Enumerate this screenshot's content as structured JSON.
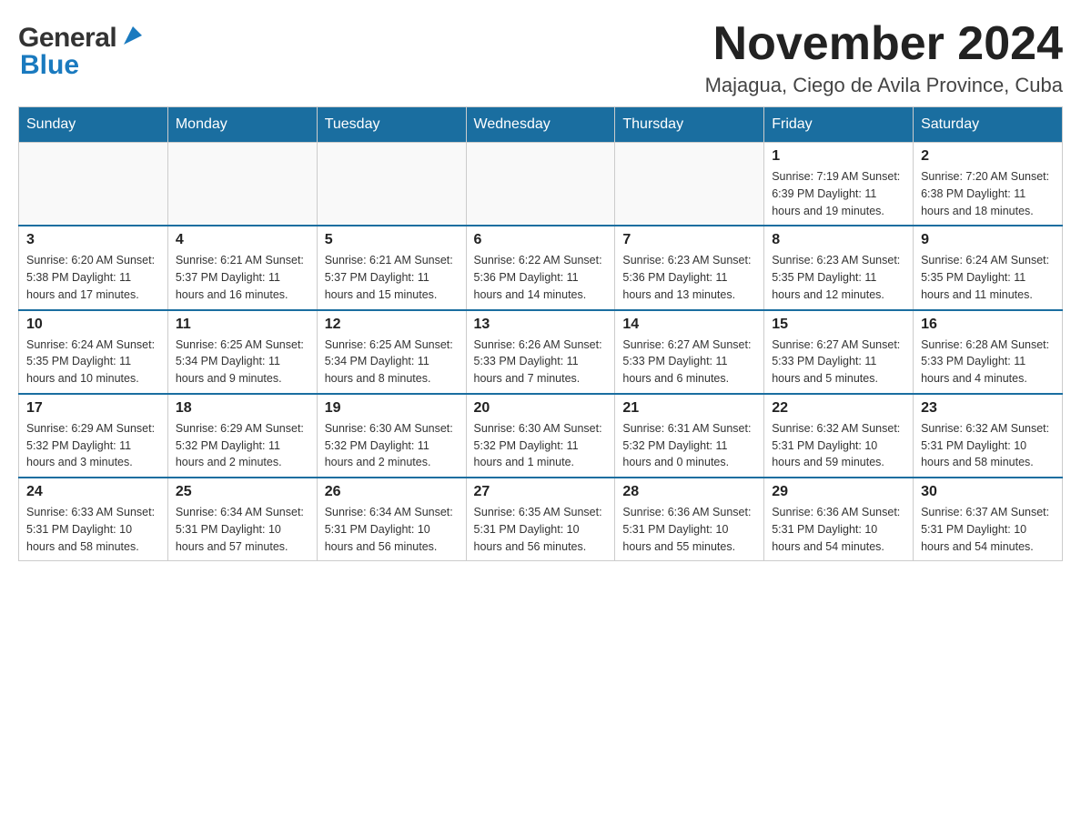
{
  "header": {
    "logo_general": "General",
    "logo_blue": "Blue",
    "month_title": "November 2024",
    "location": "Majagua, Ciego de Avila Province, Cuba"
  },
  "weekdays": [
    "Sunday",
    "Monday",
    "Tuesday",
    "Wednesday",
    "Thursday",
    "Friday",
    "Saturday"
  ],
  "weeks": [
    {
      "days": [
        {
          "number": "",
          "info": ""
        },
        {
          "number": "",
          "info": ""
        },
        {
          "number": "",
          "info": ""
        },
        {
          "number": "",
          "info": ""
        },
        {
          "number": "",
          "info": ""
        },
        {
          "number": "1",
          "info": "Sunrise: 7:19 AM\nSunset: 6:39 PM\nDaylight: 11 hours and 19 minutes."
        },
        {
          "number": "2",
          "info": "Sunrise: 7:20 AM\nSunset: 6:38 PM\nDaylight: 11 hours and 18 minutes."
        }
      ]
    },
    {
      "days": [
        {
          "number": "3",
          "info": "Sunrise: 6:20 AM\nSunset: 5:38 PM\nDaylight: 11 hours and 17 minutes."
        },
        {
          "number": "4",
          "info": "Sunrise: 6:21 AM\nSunset: 5:37 PM\nDaylight: 11 hours and 16 minutes."
        },
        {
          "number": "5",
          "info": "Sunrise: 6:21 AM\nSunset: 5:37 PM\nDaylight: 11 hours and 15 minutes."
        },
        {
          "number": "6",
          "info": "Sunrise: 6:22 AM\nSunset: 5:36 PM\nDaylight: 11 hours and 14 minutes."
        },
        {
          "number": "7",
          "info": "Sunrise: 6:23 AM\nSunset: 5:36 PM\nDaylight: 11 hours and 13 minutes."
        },
        {
          "number": "8",
          "info": "Sunrise: 6:23 AM\nSunset: 5:35 PM\nDaylight: 11 hours and 12 minutes."
        },
        {
          "number": "9",
          "info": "Sunrise: 6:24 AM\nSunset: 5:35 PM\nDaylight: 11 hours and 11 minutes."
        }
      ]
    },
    {
      "days": [
        {
          "number": "10",
          "info": "Sunrise: 6:24 AM\nSunset: 5:35 PM\nDaylight: 11 hours and 10 minutes."
        },
        {
          "number": "11",
          "info": "Sunrise: 6:25 AM\nSunset: 5:34 PM\nDaylight: 11 hours and 9 minutes."
        },
        {
          "number": "12",
          "info": "Sunrise: 6:25 AM\nSunset: 5:34 PM\nDaylight: 11 hours and 8 minutes."
        },
        {
          "number": "13",
          "info": "Sunrise: 6:26 AM\nSunset: 5:33 PM\nDaylight: 11 hours and 7 minutes."
        },
        {
          "number": "14",
          "info": "Sunrise: 6:27 AM\nSunset: 5:33 PM\nDaylight: 11 hours and 6 minutes."
        },
        {
          "number": "15",
          "info": "Sunrise: 6:27 AM\nSunset: 5:33 PM\nDaylight: 11 hours and 5 minutes."
        },
        {
          "number": "16",
          "info": "Sunrise: 6:28 AM\nSunset: 5:33 PM\nDaylight: 11 hours and 4 minutes."
        }
      ]
    },
    {
      "days": [
        {
          "number": "17",
          "info": "Sunrise: 6:29 AM\nSunset: 5:32 PM\nDaylight: 11 hours and 3 minutes."
        },
        {
          "number": "18",
          "info": "Sunrise: 6:29 AM\nSunset: 5:32 PM\nDaylight: 11 hours and 2 minutes."
        },
        {
          "number": "19",
          "info": "Sunrise: 6:30 AM\nSunset: 5:32 PM\nDaylight: 11 hours and 2 minutes."
        },
        {
          "number": "20",
          "info": "Sunrise: 6:30 AM\nSunset: 5:32 PM\nDaylight: 11 hours and 1 minute."
        },
        {
          "number": "21",
          "info": "Sunrise: 6:31 AM\nSunset: 5:32 PM\nDaylight: 11 hours and 0 minutes."
        },
        {
          "number": "22",
          "info": "Sunrise: 6:32 AM\nSunset: 5:31 PM\nDaylight: 10 hours and 59 minutes."
        },
        {
          "number": "23",
          "info": "Sunrise: 6:32 AM\nSunset: 5:31 PM\nDaylight: 10 hours and 58 minutes."
        }
      ]
    },
    {
      "days": [
        {
          "number": "24",
          "info": "Sunrise: 6:33 AM\nSunset: 5:31 PM\nDaylight: 10 hours and 58 minutes."
        },
        {
          "number": "25",
          "info": "Sunrise: 6:34 AM\nSunset: 5:31 PM\nDaylight: 10 hours and 57 minutes."
        },
        {
          "number": "26",
          "info": "Sunrise: 6:34 AM\nSunset: 5:31 PM\nDaylight: 10 hours and 56 minutes."
        },
        {
          "number": "27",
          "info": "Sunrise: 6:35 AM\nSunset: 5:31 PM\nDaylight: 10 hours and 56 minutes."
        },
        {
          "number": "28",
          "info": "Sunrise: 6:36 AM\nSunset: 5:31 PM\nDaylight: 10 hours and 55 minutes."
        },
        {
          "number": "29",
          "info": "Sunrise: 6:36 AM\nSunset: 5:31 PM\nDaylight: 10 hours and 54 minutes."
        },
        {
          "number": "30",
          "info": "Sunrise: 6:37 AM\nSunset: 5:31 PM\nDaylight: 10 hours and 54 minutes."
        }
      ]
    }
  ],
  "colors": {
    "header_bg": "#1a6ea0",
    "header_text": "#ffffff",
    "border": "#cccccc",
    "day_number": "#222222",
    "day_info": "#333333"
  }
}
